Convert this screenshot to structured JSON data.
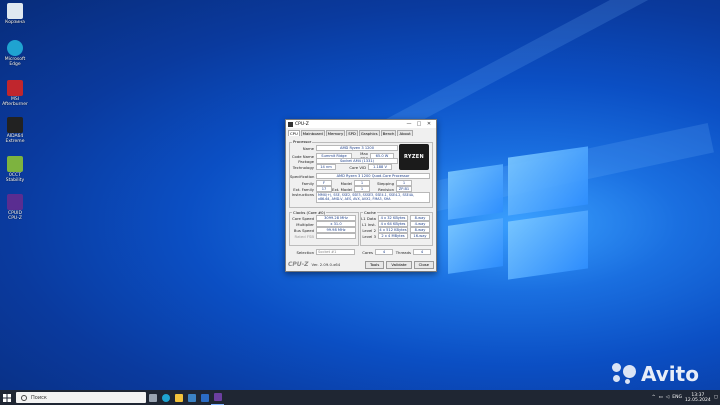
{
  "desktop": {
    "icons": [
      {
        "label": "Корзина",
        "color": "#dfe8f0"
      },
      {
        "label": "Microsoft Edge",
        "color": "#1fa3d1"
      },
      {
        "label": "MSI Afterburner",
        "color": "#c0262d"
      },
      {
        "label": "AIDA64 Extreme",
        "color": "#222222"
      },
      {
        "label": "0CCT Stability",
        "color": "#7db33f"
      },
      {
        "label": "CPUID CPU-Z",
        "color": "#5a2d91"
      }
    ]
  },
  "cpuz": {
    "title": "CPU-Z",
    "window_buttons": [
      "—",
      "□",
      "✕"
    ],
    "tabs": [
      "CPU",
      "Mainboard",
      "Memory",
      "SPD",
      "Graphics",
      "Bench",
      "About"
    ],
    "active_tab": "CPU",
    "processor": {
      "group_title": "Processor",
      "name_label": "Name",
      "name": "AMD Ryzen 3 1200",
      "codename_label": "Code Name",
      "codename": "Summit Ridge",
      "maxtdp_label": "Max TDP",
      "maxtdp": "65.0 W",
      "package_label": "Package",
      "package": "Socket AM4 (1331)",
      "technology_label": "Technology",
      "technology": "14 nm",
      "corevid_label": "Core VID",
      "corevid": "1.188 V",
      "logo_text": "RYZEN"
    },
    "spec": {
      "specification_label": "Specification",
      "specification": "AMD Ryzen 3 1200 Quad-Core Processor",
      "family_label": "Family",
      "family": "F",
      "model_label": "Model",
      "model": "1",
      "stepping_label": "Stepping",
      "stepping": "1",
      "extfamily_label": "Ext. Family",
      "extfamily": "17",
      "extmodel_label": "Ext. Model",
      "extmodel": "1",
      "revision_label": "Revision",
      "revision": "ZP-B1",
      "instructions_label": "Instructions",
      "instructions_line1": "MMX(+), SSE, SSE2, SSE3, SSSE3, SSE4.1, SSE4.2, SSE4A,",
      "instructions_line2": "x86-64, AMD-V, AES, AVX, AVX2, FMA3, SHA"
    },
    "clocks": {
      "group_title": "Clocks (Core #0)",
      "corespeed_label": "Core Speed",
      "corespeed": "3099.28 MHz",
      "multiplier_label": "Multiplier",
      "multiplier": "x 31.0",
      "busspeed_label": "Bus Speed",
      "busspeed": "99.98 MHz",
      "ratedfsb_label": "Rated FSB",
      "ratedfsb": ""
    },
    "cache": {
      "group_title": "Cache",
      "rows": [
        {
          "label": "L1 Data",
          "size": "4 x 32 KBytes",
          "way": "8-way"
        },
        {
          "label": "L1 Inst.",
          "size": "4 x 64 KBytes",
          "way": "4-way"
        },
        {
          "label": "Level 2",
          "size": "4 x 512 KBytes",
          "way": "8-way"
        },
        {
          "label": "Level 3",
          "size": "2 x 4 MBytes",
          "way": "16-way"
        }
      ]
    },
    "selection": {
      "selection_label": "Selection",
      "selection_value": "Socket #1",
      "cores_label": "Cores",
      "cores": "4",
      "threads_label": "Threads",
      "threads": "4"
    },
    "footer": {
      "brand": "CPU-Z",
      "version": "Ver. 2.09.0.x64",
      "tools": "Tools",
      "validate": "Validate",
      "close": "Close"
    }
  },
  "taskbar": {
    "search_placeholder": "Поиск",
    "apps": [
      {
        "name": "task-view",
        "color": "#9aa4b2"
      },
      {
        "name": "edge",
        "color": "#1fa3d1"
      },
      {
        "name": "file-explorer",
        "color": "#f3c33c"
      },
      {
        "name": "store",
        "color": "#3b82c4"
      },
      {
        "name": "mail",
        "color": "#2b6cc4"
      },
      {
        "name": "cpu-z",
        "color": "#6b3fa0"
      }
    ],
    "lang": "ENG",
    "time": "13:37",
    "date": "12.05.2024"
  },
  "watermark": {
    "text": "Avito"
  }
}
